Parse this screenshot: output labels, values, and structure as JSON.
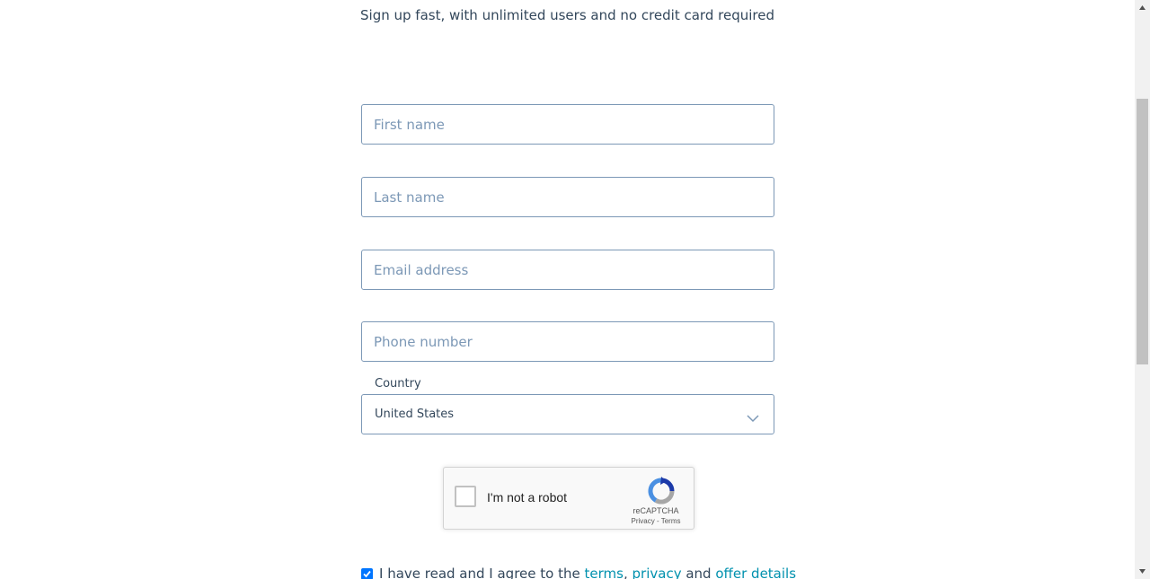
{
  "subtitle": "Sign up fast, with unlimited users and no credit card required",
  "form": {
    "first_name_placeholder": "First name",
    "last_name_placeholder": "Last name",
    "email_placeholder": "Email address",
    "phone_placeholder": "Phone number",
    "country_label": "Country",
    "country_value": "United States"
  },
  "recaptcha": {
    "label": "I'm not a robot",
    "brand": "reCAPTCHA",
    "privacy": "Privacy",
    "separator": "-",
    "terms": "Terms",
    "checked": false
  },
  "agreement": {
    "checked": true,
    "text_before": "I have read and I agree to the",
    "terms_link": "terms",
    "comma": ",",
    "privacy_link": "privacy",
    "and": "and",
    "offer_link": "offer details"
  },
  "colors": {
    "accent_link": "#0091ae",
    "field_border": "#7c98b6",
    "checkbox_checked": "#0075ff"
  }
}
